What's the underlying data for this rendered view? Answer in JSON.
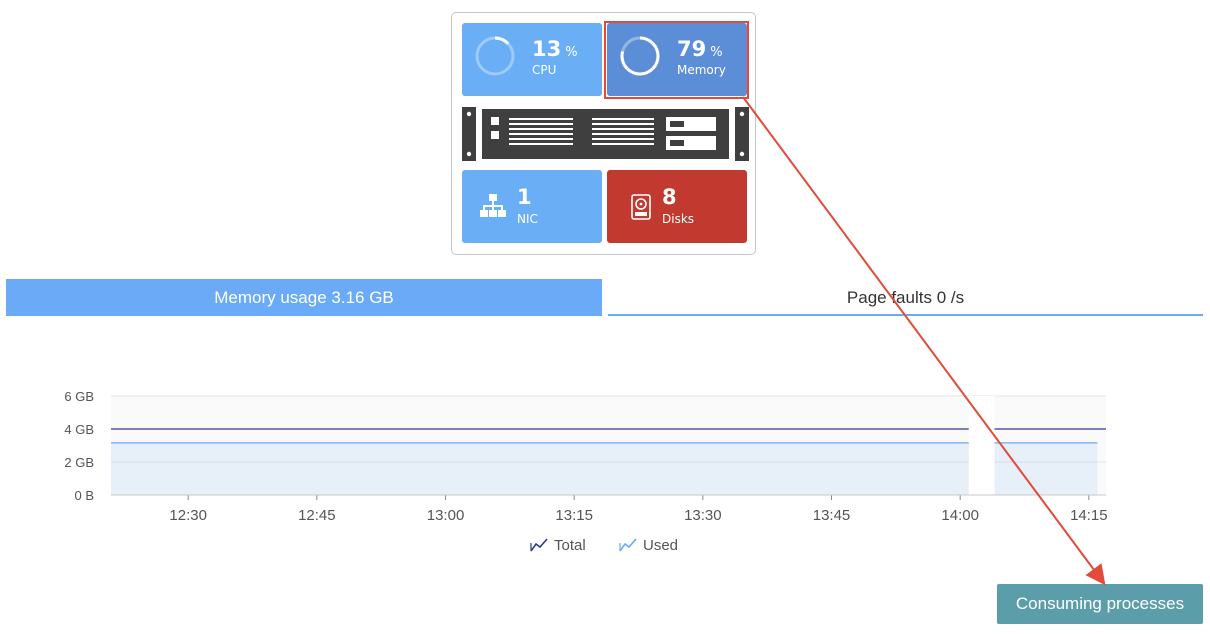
{
  "host": {
    "cpu": {
      "value": "13",
      "unit": "%",
      "label": "CPU",
      "percent": 13
    },
    "memory": {
      "value": "79",
      "unit": "%",
      "label": "Memory",
      "percent": 79
    },
    "nic": {
      "value": "1",
      "label": "NIC"
    },
    "disks": {
      "value": "8",
      "label": "Disks"
    }
  },
  "tabs": {
    "memory_label": "Memory usage 3.16 GB",
    "faults_label": "Page faults 0 /s"
  },
  "chart_data": {
    "type": "line",
    "y_ticks": [
      "6 GB",
      "4 GB",
      "2 GB",
      "0 B"
    ],
    "y_tick_values": [
      6,
      4,
      2,
      0
    ],
    "ylim": [
      0,
      6
    ],
    "x_ticks": [
      "12:30",
      "12:45",
      "13:00",
      "13:15",
      "13:30",
      "13:45",
      "14:00",
      "14:15"
    ],
    "x_range": [
      "12:21",
      "14:17"
    ],
    "series": [
      {
        "name": "Total",
        "color": "#2f3c8e",
        "segments": [
          [
            [
              "12:21",
              4
            ],
            [
              "14:01",
              4
            ]
          ],
          [
            [
              "14:04",
              4
            ],
            [
              "14:17",
              4
            ]
          ]
        ]
      },
      {
        "name": "Used",
        "color": "#6aaaf6",
        "fill": true,
        "segments": [
          [
            [
              "12:21",
              3.16
            ],
            [
              "14:01",
              3.16
            ]
          ],
          [
            [
              "14:04",
              3.16
            ],
            [
              "14:16",
              3.16
            ]
          ]
        ]
      }
    ],
    "gap": [
      "14:01",
      "14:04"
    ]
  },
  "legend": {
    "total": "Total",
    "used": "Used"
  },
  "actions": {
    "consuming_processes": "Consuming processes"
  },
  "colors": {
    "accent": "#6aaaf6",
    "memory_tile": "#5c8ed8",
    "disk_tile": "#c1392f",
    "button": "#5b9ea9",
    "annotation": "#e24b3b"
  }
}
